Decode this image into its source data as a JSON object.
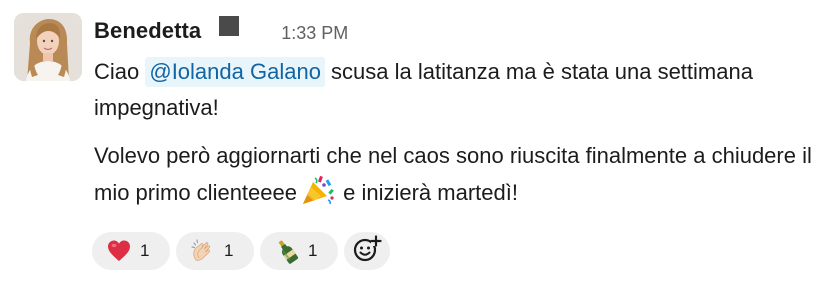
{
  "message": {
    "sender": "Benedetta",
    "timestamp": "1:33 PM",
    "paragraph1": {
      "prefix": "Ciao ",
      "mention": "@Iolanda Galano",
      "suffix": " scusa la latitanza ma è stata una settimana impegnativa!"
    },
    "paragraph2": {
      "before_emoji": "Volevo però aggiornarti che nel caos sono riuscita finalmente a chiudere il mio primo clienteeee",
      "emoji": "party-popper-icon",
      "after_emoji": " e inizierà martedì!"
    }
  },
  "reactions": [
    {
      "emoji": "red-heart-icon",
      "count": "1"
    },
    {
      "emoji": "clapping-hands-icon",
      "count": "1"
    },
    {
      "emoji": "champagne-bottle-icon",
      "count": "1"
    }
  ],
  "add_reaction": {
    "icon": "add-emoji-icon"
  },
  "colors": {
    "mention_bg": "#e8f5fa",
    "mention_text": "#1264a3",
    "reaction_bg": "#efefef",
    "timestamp": "#616061"
  }
}
